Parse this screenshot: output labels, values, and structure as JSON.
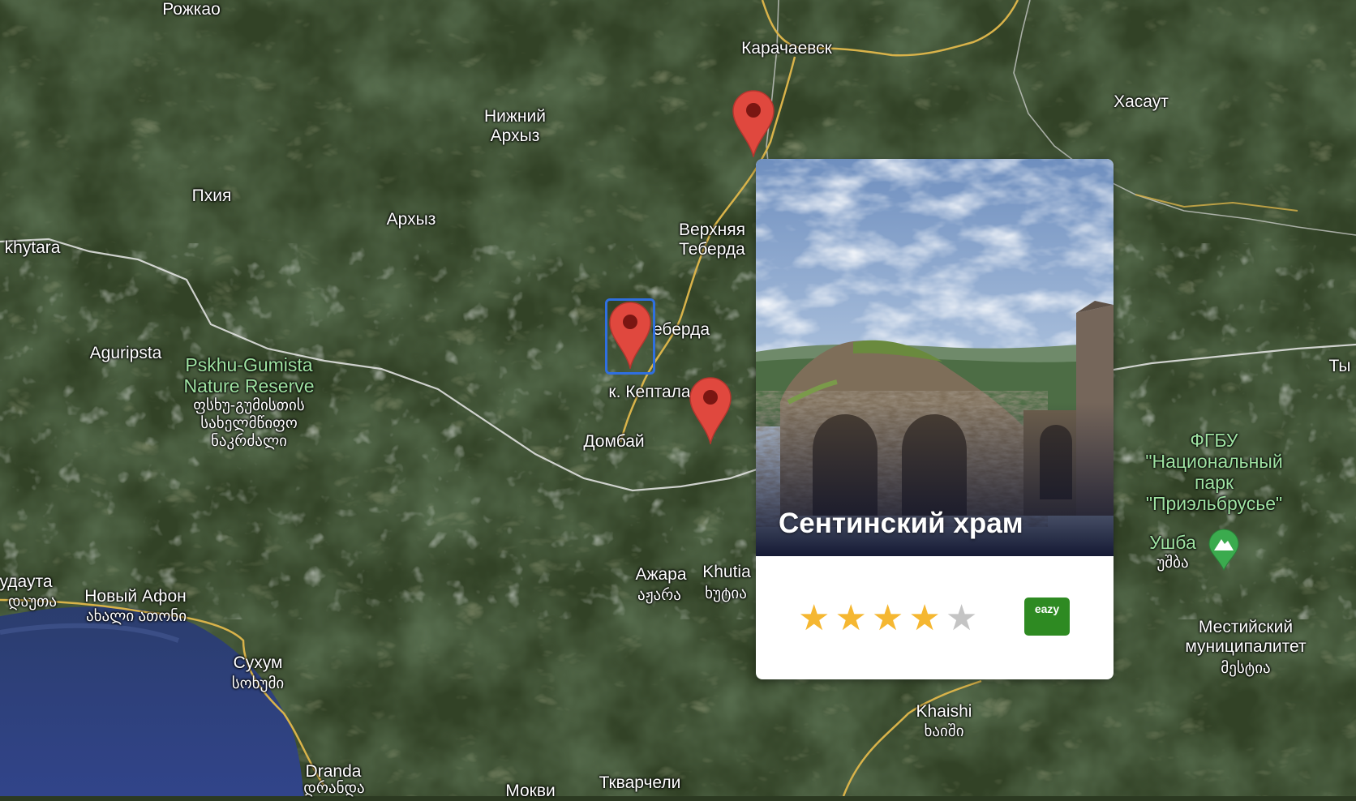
{
  "map": {
    "labels": {
      "rozhkao": "Рожкао",
      "karachaevsk": "Карачаевск",
      "khasaut": "Хасаут",
      "nizhny_arkhyz_1": "Нижний",
      "nizhny_arkhyz_2": "Архыз",
      "pkhia": "Пхия",
      "arkhyz": "Архыз",
      "verkhnyaya_teberda_1": "Верхняя",
      "verkhnyaya_teberda_2": "Теберда",
      "khytara": "khytara",
      "teberda": "еберда",
      "aguripsta": "Aguripsta",
      "pskhu_1": "Pskhu-Gumista",
      "pskhu_2": "Nature Reserve",
      "pskhu_ka_1": "ფსხუ-გუმისთის",
      "pskhu_ka_2": "სახელმწიფო",
      "pskhu_ka_3": "ნაკრძალი",
      "keptala": "к. Кептала",
      "dombai": "Домбай",
      "ty": "Ты",
      "fgbu_1": "ФГБУ",
      "fgbu_2": "\"Национальный",
      "fgbu_3": "парк",
      "fgbu_4": "\"Приэльбрусье\"",
      "ushba": "Ушба",
      "ushba_ka": "უშბა",
      "gudauta": "удаута",
      "gudauta_ka": "დაუთა",
      "novy_afon": "Новый Афон",
      "novy_afon_ka": "ახალი ათონი",
      "azhara": "Ажара",
      "azhara_ka": "აჟარა",
      "khutia": "Khutia",
      "khutia_ka": "ხუტია",
      "mestia_1": "Местийский",
      "mestia_2": "муниципалитет",
      "mestia_ka": "მესტია",
      "sukhum": "Сухум",
      "sukhum_ka": "სოხუმი",
      "khaishi": "Khaishi",
      "khaishi_ka": "ხაიში",
      "dranda": "Dranda",
      "dranda_ka": "დრანდა",
      "mokvi": "Мокви",
      "tkvarcheli": "Ткварчели"
    },
    "marker_color": "#e0483e",
    "selected_outline_color": "#2f6fe0",
    "markers": [
      "marker-north",
      "marker-teberda-selected",
      "marker-dombai"
    ]
  },
  "card": {
    "title": "Сентинский храм",
    "rating": 4,
    "max_rating": 5,
    "star_filled_color": "#f5b731",
    "star_empty_color": "#c4c4c4",
    "badge_label": "eazy",
    "badge_color": "#2e8a22"
  },
  "poi": {
    "ushba_icon": "mountain-icon"
  }
}
